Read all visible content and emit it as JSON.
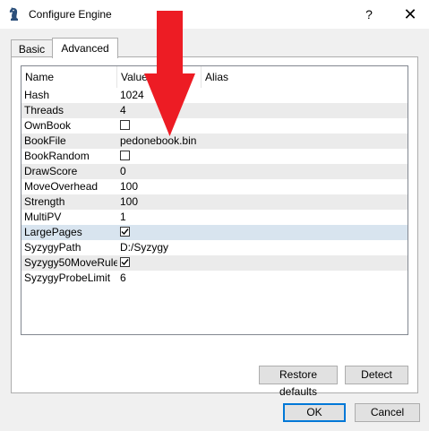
{
  "window": {
    "title": "Configure Engine",
    "icon": "chess-knight-icon",
    "help_label": "?",
    "close_label": "✕"
  },
  "tabs": [
    {
      "label": "Basic",
      "active": false
    },
    {
      "label": "Advanced",
      "active": true
    }
  ],
  "table": {
    "headers": {
      "name": "Name",
      "value": "Value",
      "alias": "Alias"
    },
    "rows": [
      {
        "name": "Hash",
        "value": "1024"
      },
      {
        "name": "Threads",
        "value": "4"
      },
      {
        "name": "OwnBook",
        "checkbox": false
      },
      {
        "name": "BookFile",
        "value": "pedonebook.bin"
      },
      {
        "name": "BookRandom",
        "checkbox": false
      },
      {
        "name": "DrawScore",
        "value": "0"
      },
      {
        "name": "MoveOverhead",
        "value": "100"
      },
      {
        "name": "Strength",
        "value": "100"
      },
      {
        "name": "MultiPV",
        "value": "1"
      },
      {
        "name": "LargePages",
        "checkbox": true,
        "selected": true
      },
      {
        "name": "SyzygyPath",
        "value": "D:/Syzygy"
      },
      {
        "name": "Syzygy50MoveRule",
        "checkbox": true
      },
      {
        "name": "SyzygyProbeLimit",
        "value": "6"
      }
    ]
  },
  "buttons": {
    "restore_defaults": "Restore defaults",
    "detect": "Detect",
    "ok": "OK",
    "cancel": "Cancel"
  },
  "annotation": {
    "arrow_color": "#ed1c24",
    "arrow_icon": "red-down-arrow"
  }
}
